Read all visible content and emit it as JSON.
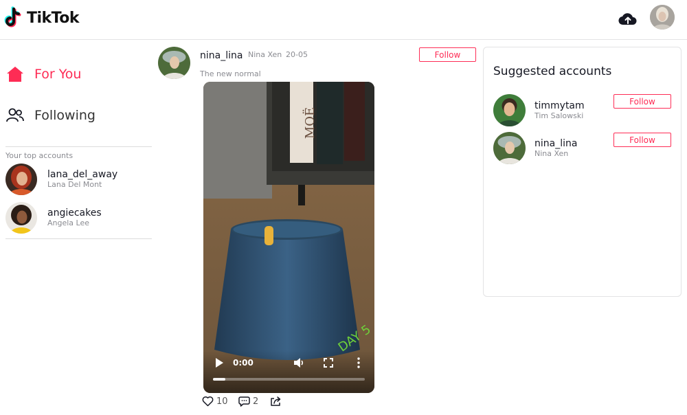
{
  "header": {
    "logo_text": "TikTok",
    "upload_icon": "cloud-upload-icon",
    "avatar_icon": "user-avatar"
  },
  "sidebar": {
    "nav": [
      {
        "label": "For You",
        "icon": "home-icon",
        "active": true
      },
      {
        "label": "Following",
        "icon": "users-icon",
        "active": false
      }
    ],
    "top_accounts_title": "Your top accounts",
    "accounts": [
      {
        "username": "lana_del_away",
        "name": "Lana Del Mont"
      },
      {
        "username": "angiecakes",
        "name": "Angela Lee"
      }
    ]
  },
  "post": {
    "username": "nina_lina",
    "name": "Nina Xen",
    "date": "20-05",
    "caption": "The new normal",
    "follow_label": "Follow",
    "video": {
      "time": "0:00",
      "progress": 0.08,
      "overlay_text": "DAY 5",
      "book_text": "MOË"
    },
    "likes": "10",
    "comments": "2"
  },
  "suggested": {
    "title": "Suggested accounts",
    "accounts": [
      {
        "username": "timmytam",
        "name": "Tim Salowski",
        "follow_label": "Follow"
      },
      {
        "username": "nina_lina",
        "name": "Nina Xen",
        "follow_label": "Follow"
      }
    ]
  },
  "colors": {
    "accent": "#fe2c55",
    "muted": "#8a8b91",
    "text": "#161823"
  }
}
